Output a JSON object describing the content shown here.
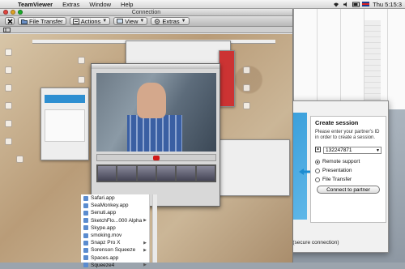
{
  "menubar": {
    "app_name": "TeamViewer",
    "items": [
      "Extras",
      "Window",
      "Help"
    ],
    "clock": "Thu 5:15:3"
  },
  "tv_window": {
    "title": "Connection",
    "toolbar": {
      "file_transfer": "File Transfer",
      "actions": "Actions",
      "view": "View",
      "extras": "Extras"
    }
  },
  "tv_main": {
    "create_session": {
      "heading": "Create session",
      "prompt": "Please enter your partner's ID in order to create a session.",
      "partner_id": "132247871",
      "options": [
        {
          "label": "Remote support",
          "selected": true
        },
        {
          "label": "Presentation",
          "selected": false
        },
        {
          "label": "File Transfer",
          "selected": false
        }
      ],
      "connect_button": "Connect to partner"
    },
    "status_text": "Ready to connect (secure connection)"
  },
  "app_list": [
    {
      "label": "Safari.app",
      "has_arrow": false
    },
    {
      "label": "SeaMonkey.app",
      "has_arrow": false
    },
    {
      "label": "Senuti.app",
      "has_arrow": false
    },
    {
      "label": "SketchFlo...000 Alpha",
      "has_arrow": true
    },
    {
      "label": "Skype.app",
      "has_arrow": false
    },
    {
      "label": "smoking.mov",
      "has_arrow": false
    },
    {
      "label": "Snapz Pro X",
      "has_arrow": true
    },
    {
      "label": "Sorenson Squeeze",
      "has_arrow": true
    },
    {
      "label": "Spaces.app",
      "has_arrow": false
    },
    {
      "label": "Squeeze4",
      "has_arrow": true
    }
  ],
  "colors": {
    "accent_blue": "#1b8bd0",
    "ready_green": "#3bb53b",
    "record_red": "#d01818"
  }
}
